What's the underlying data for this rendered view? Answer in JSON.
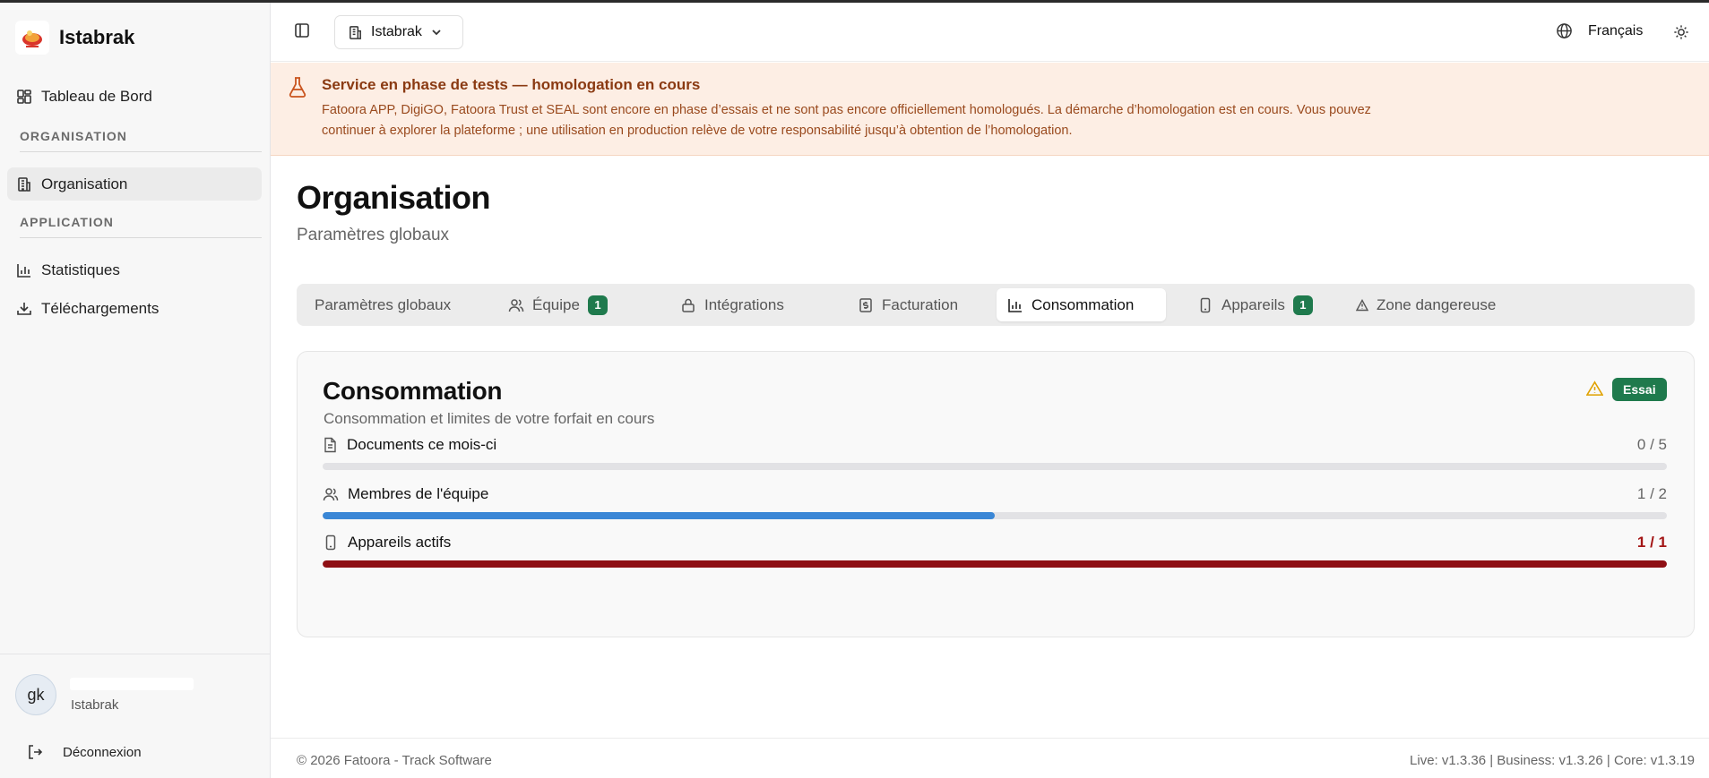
{
  "app": {
    "name": "Istabrak"
  },
  "sidebar": {
    "items": [
      {
        "label": "Tableau de Bord",
        "icon": "dashboard-icon"
      },
      {
        "label": "Organisation",
        "icon": "building-icon",
        "active": true
      },
      {
        "label": "Statistiques",
        "icon": "bar-chart-icon"
      },
      {
        "label": "Téléchargements",
        "icon": "download-icon"
      }
    ],
    "sections": {
      "organisation": "ORGANISATION",
      "application": "APPLICATION"
    },
    "user": {
      "initials": "gk",
      "org": "Istabrak"
    },
    "logout_label": "Déconnexion"
  },
  "header": {
    "org_selector": "Istabrak",
    "language": "Français"
  },
  "banner": {
    "title": "Service en phase de tests — homologation en cours",
    "text": "Fatoora APP, DigiGO, Fatoora Trust et SEAL sont encore en phase d’essais et ne sont pas encore officiellement homologués. La démarche d’homologation est en cours. Vous pouvez continuer à explorer la plateforme ; une utilisation en production relève de votre responsabilité jusqu’à obtention de l’homologation."
  },
  "page": {
    "title": "Organisation",
    "subtitle": "Paramètres globaux"
  },
  "tabs": [
    {
      "label": "Paramètres globaux"
    },
    {
      "label": "Équipe",
      "badge": "1",
      "icon": "users-icon"
    },
    {
      "label": "Intégrations",
      "icon": "lock-icon"
    },
    {
      "label": "Facturation",
      "icon": "dollar-receipt-icon"
    },
    {
      "label": "Consommation",
      "icon": "bar-chart-icon",
      "active": true
    },
    {
      "label": "Appareils",
      "badge": "1",
      "icon": "smartphone-icon"
    },
    {
      "label": "Zone dangereuse",
      "icon": "warning-icon"
    }
  ],
  "consumption": {
    "title": "Consommation",
    "subtitle": "Consommation et limites de votre forfait en cours",
    "plan_badge": "Essai",
    "items": [
      {
        "label": "Documents ce mois-ci",
        "value": "0 / 5",
        "used": 0,
        "limit": 5,
        "icon": "document-icon",
        "color": "#2f80d1"
      },
      {
        "label": "Membres de l'équipe",
        "value": "1 / 2",
        "used": 1,
        "limit": 2,
        "icon": "users-icon",
        "color": "#3a87d6"
      },
      {
        "label": "Appareils actifs",
        "value": "1 / 1",
        "used": 1,
        "limit": 1,
        "icon": "smartphone-icon",
        "color": "#8f0f14",
        "critical": true
      }
    ]
  },
  "footer": {
    "copyright": "© 2026 Fatoora - Track Software",
    "versions": "Live: v1.3.36 | Business: v1.3.26 | Core: v1.3.19"
  },
  "colors": {
    "accent_green": "#1f7a4d",
    "banner_bg": "#fdeee4",
    "critical": "#8f0f14",
    "progress": "#3a87d6"
  }
}
